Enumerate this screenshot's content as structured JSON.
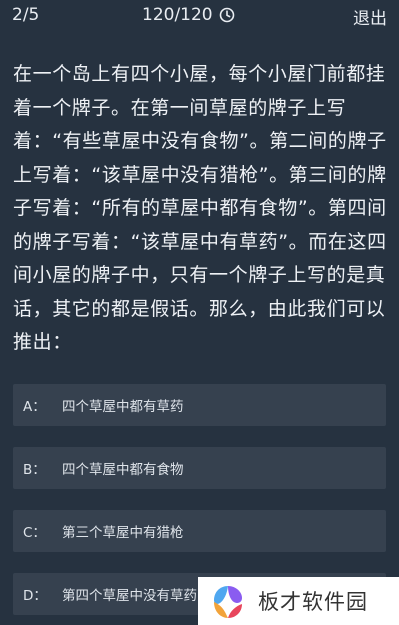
{
  "header": {
    "progress": "2/5",
    "timer": "120/120",
    "timer_icon": "clock-icon",
    "exit_label": "退出"
  },
  "question": {
    "text": "在一个岛上有四个小屋，每个小屋门前都挂着一个牌子。在第一间草屋的牌子上写着：“有些草屋中没有食物”。第二间的牌子上写着：“该草屋中没有猎枪”。第三间的牌子写着：“所有的草屋中都有食物”。第四间的牌子写着：“该草屋中有草药”。而在这四间小屋的牌子中，只有一个牌子上写的是真话，其它的都是假话。那么，由此我们可以推出："
  },
  "options": [
    {
      "letter": "A：",
      "text": "四个草屋中都有草药"
    },
    {
      "letter": "B：",
      "text": "四个草屋中都有食物"
    },
    {
      "letter": "C：",
      "text": "第三个草屋中有猎枪"
    },
    {
      "letter": "D：",
      "text": "第四个草屋中没有草药"
    }
  ],
  "watermark": {
    "text": "板才软件园",
    "logo_icon": "site-logo-icon",
    "colors": [
      "#f2a33a",
      "#e8465c",
      "#4fa7f0",
      "#8a5cf0"
    ]
  },
  "colors": {
    "background": "#263240",
    "option_background": "#36414f",
    "text": "#e9edf2"
  }
}
